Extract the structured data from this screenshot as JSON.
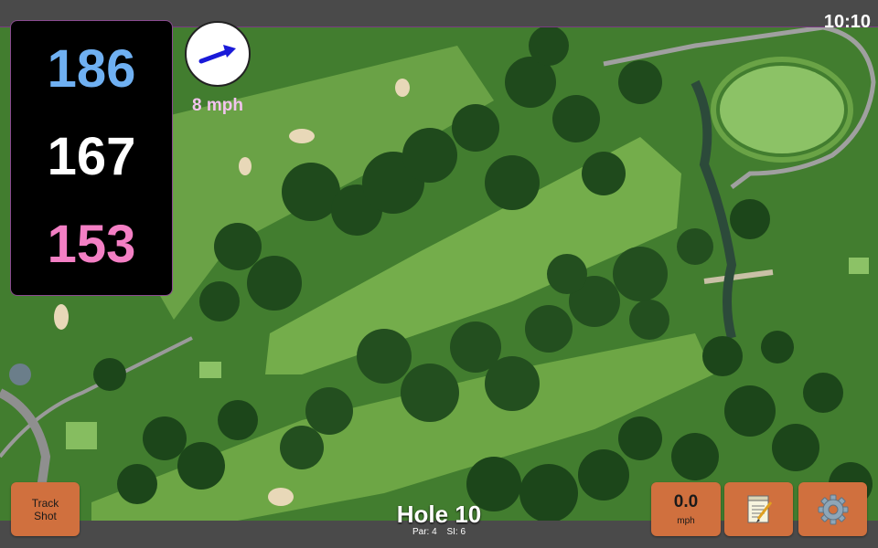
{
  "clock": "10:10",
  "distances": {
    "back": "186",
    "middle": "167",
    "front": "153"
  },
  "colors": {
    "back": "#6fb0f2",
    "middle": "#ffffff",
    "front": "#f37fc4",
    "wind_arrow": "#1a1ad8",
    "wind_label": "#f2c3ee",
    "button": "#d0703e"
  },
  "wind": {
    "label": "8 mph",
    "direction_icon": "wind-arrow-icon"
  },
  "track_shot": {
    "line1": "Track",
    "line2": "Shot"
  },
  "wind_button": {
    "value": "0.0",
    "unit": "mph"
  },
  "hole": {
    "title": "Hole 10",
    "par": "Par: 4",
    "si": "SI: 6"
  },
  "icons": {
    "notes": "notepad-icon",
    "settings": "gear-icon"
  }
}
